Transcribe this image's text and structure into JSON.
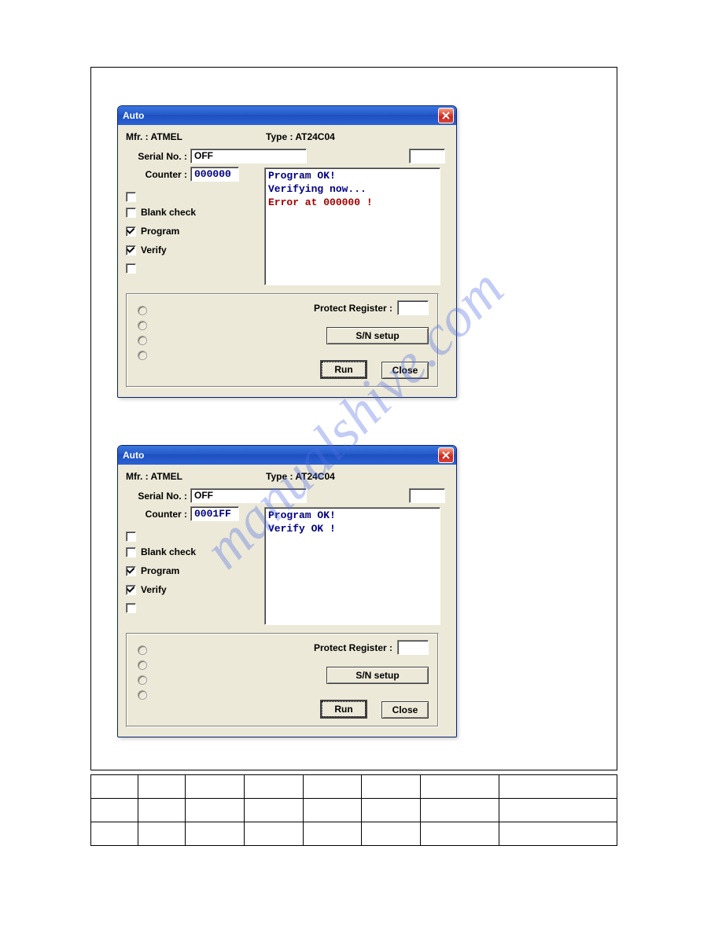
{
  "watermark": "manualshive.com",
  "dialog1": {
    "title": "Auto",
    "mfr_label": "Mfr. : ATMEL",
    "type_label": "Type : AT24C04",
    "serial_label": "Serial No. :",
    "serial_value": "OFF",
    "counter_label": "Counter :",
    "counter_value": "000000",
    "log": {
      "line1": "Program OK!",
      "line2": "Verifying now...",
      "line3": "Error at 000000 !"
    },
    "cb_blank": "Blank check",
    "cb_program": "Program",
    "cb_verify": "Verify",
    "protect_label": "Protect Register :",
    "btn_sn": "S/N setup",
    "btn_run": "Run",
    "btn_close": "Close"
  },
  "dialog2": {
    "title": "Auto",
    "mfr_label": "Mfr. : ATMEL",
    "type_label": "Type : AT24C04",
    "serial_label": "Serial No. :",
    "serial_value": "OFF",
    "counter_label": "Counter :",
    "counter_value": "0001FF",
    "log": {
      "line1": "Program OK!",
      "line2": "Verify OK !"
    },
    "cb_blank": "Blank check",
    "cb_program": "Program",
    "cb_verify": "Verify",
    "protect_label": "Protect Register :",
    "btn_sn": "S/N setup",
    "btn_run": "Run",
    "btn_close": "Close"
  }
}
